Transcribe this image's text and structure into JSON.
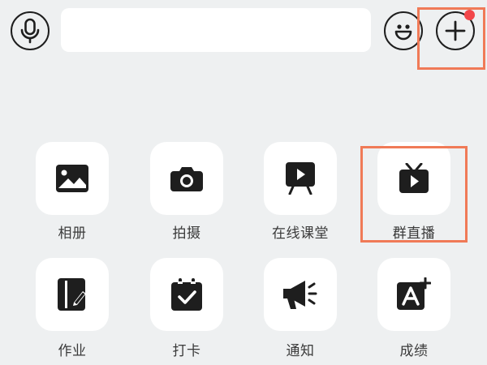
{
  "input_bar": {
    "text_value": "",
    "voice_icon": "voice-icon",
    "emoji_icon": "emoji-icon",
    "plus_icon": "plus-icon",
    "notification_dot_color": "#f2474a"
  },
  "highlight_color": "#f07a57",
  "tools": {
    "album": {
      "label": "相册",
      "icon": "image-icon"
    },
    "camera": {
      "label": "拍摄",
      "icon": "camera-icon"
    },
    "online_class": {
      "label": "在线课堂",
      "icon": "presentation-icon"
    },
    "group_live": {
      "label": "群直播",
      "icon": "tv-icon"
    },
    "homework": {
      "label": "作业",
      "icon": "homework-icon"
    },
    "check_in": {
      "label": "打卡",
      "icon": "calendar-check-icon"
    },
    "notice": {
      "label": "通知",
      "icon": "megaphone-icon"
    },
    "grades": {
      "label": "成绩",
      "icon": "grade-icon"
    }
  }
}
